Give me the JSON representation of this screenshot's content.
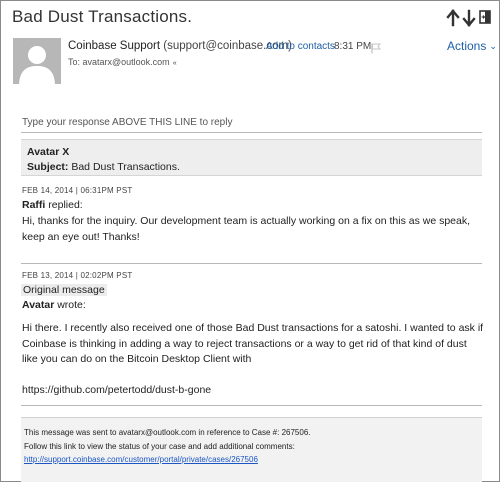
{
  "header": {
    "subject": "Bad Dust Transactions.",
    "sender_name": "Coinbase Support",
    "sender_email": "(support@coinbase.com)",
    "add_contacts": "Add to contacts",
    "time": "8:31 PM",
    "actions_label": "Actions",
    "to_line": "To: avatarx@outlook.com",
    "icons": [
      "arrow-up-icon",
      "arrow-down-icon",
      "pop-out-icon",
      "flag-icon",
      "chevron-down-icon"
    ]
  },
  "reply_instruction": "Type your response ABOVE THIS LINE to reply",
  "ticket_header": {
    "name": "Avatar X",
    "subject_label": "Subject:",
    "subject_value": "Bad Dust Transactions."
  },
  "messages": [
    {
      "meta": "FEB 14, 2014  |  06:31PM PST",
      "author": "Raffi",
      "action": "replied:",
      "body": "Hi, thanks for the inquiry. Our development team is actually working on a fix on this as we speak, keep an eye out! Thanks!"
    },
    {
      "meta": "FEB 13, 2014  |  02:02PM PST",
      "label": "Original message",
      "author": "Avatar",
      "action": "wrote:",
      "body": "Hi there. I recently also received one of those Bad Dust transactions for a satoshi. I wanted to ask if Coinbase is thinking in adding a way to reject transactions or a way to get rid of that kind of dust like you can do on the Bitcoin Desktop Client with",
      "link": "https://github.com/petertodd/dust-b-gone"
    }
  ],
  "footer": {
    "line1": "This message was sent to avatarx@outlook.com in reference to Case #: 267506.",
    "line2": "Follow this link to view the status of your case and add additional comments:",
    "link": "http://support.coinbase.com/customer/portal/private/cases/267506"
  },
  "colors": {
    "link": "#1e5fa8",
    "avatar_bg": "#b7b7b7",
    "quote_bg": "#eeeeee"
  }
}
